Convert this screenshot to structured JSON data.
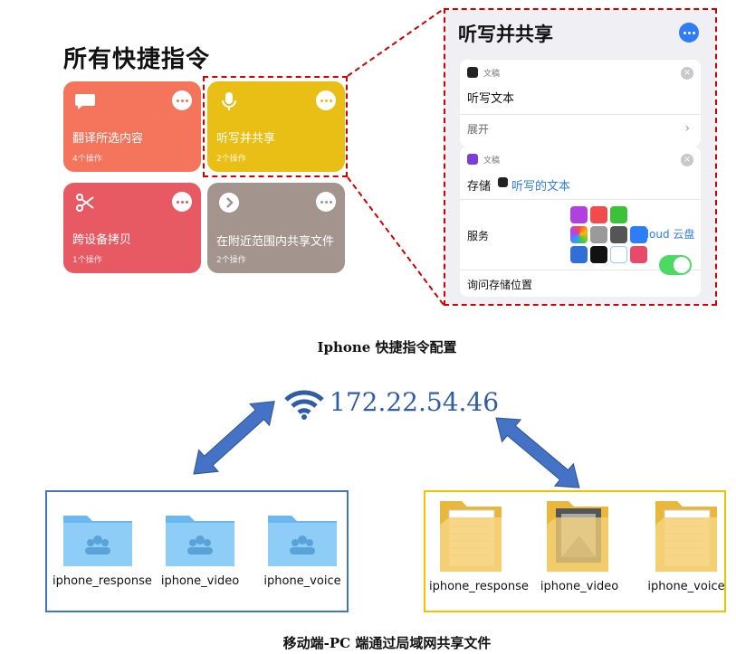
{
  "shortcuts": {
    "title": "所有快捷指令",
    "cards": [
      {
        "label": "翻译所选内容",
        "count": "4个操作",
        "color": "#f4745c",
        "icon": "speech-bubble-icon"
      },
      {
        "label": "听写并共享",
        "count": "2个操作",
        "color": "#e9bf15",
        "icon": "microphone-icon"
      },
      {
        "label": "跨设备拷贝",
        "count": "1个操作",
        "color": "#e85a63",
        "icon": "scissors-icon"
      },
      {
        "label": "在附近范围内共享文件",
        "count": "2个操作",
        "color": "#a3958e",
        "icon": "arrow-right-circle-icon"
      }
    ]
  },
  "detail": {
    "title": "听写并共享",
    "section1": {
      "tag": "文稿",
      "action": "听写文本",
      "expand": "展开"
    },
    "section2": {
      "tag": "文稿",
      "save": "存储",
      "variable": "听写的文本",
      "service_label": "服务",
      "service_value": "iCloud 云盘",
      "ask_label": "询问存储位置"
    }
  },
  "caption_top": "Iphone 快捷指令配置",
  "network": {
    "ip": "172.22.54.46",
    "accent": "#2f5da8"
  },
  "mobile_folders": [
    "iphone_response",
    "iphone_video",
    "iphone_voice"
  ],
  "pc_folders": [
    "iphone_response",
    "iphone_video",
    "iphone_voice"
  ],
  "caption_bottom": "移动端-PC 端通过局域网共享文件"
}
